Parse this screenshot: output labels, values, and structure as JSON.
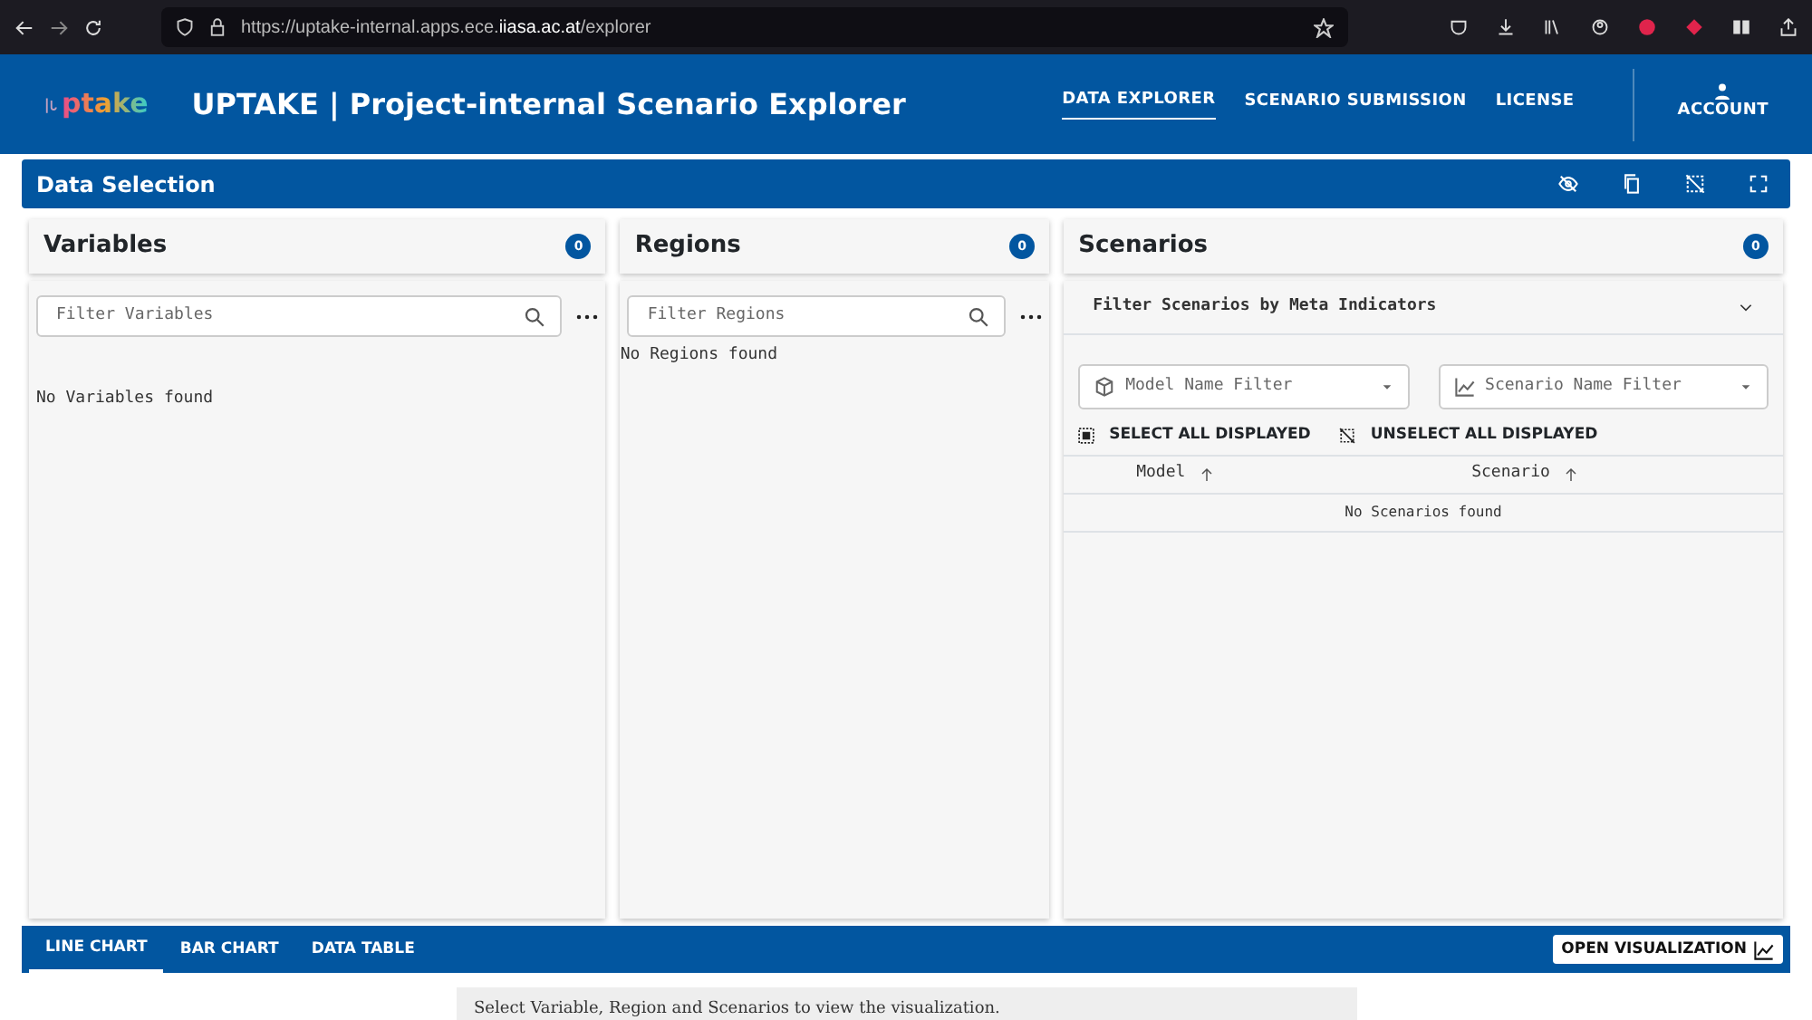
{
  "browser": {
    "url_prefix": "https://uptake-internal.apps.ece.",
    "url_host": "iiasa.ac.at",
    "url_path": "/explorer"
  },
  "header": {
    "logo": "ptake",
    "title": "UPTAKE | Project-internal Scenario Explorer",
    "nav": [
      {
        "label": "DATA EXPLORER",
        "selected": true
      },
      {
        "label": "SCENARIO SUBMISSION",
        "selected": false
      },
      {
        "label": "LICENSE",
        "selected": false
      }
    ],
    "account": "ACCOUNT"
  },
  "data_selection": {
    "title": "Data Selection"
  },
  "panels": [
    {
      "kind": "list",
      "title": "Variables",
      "count": "0",
      "placeholder": "Filter Variables",
      "empty": "No Variables found"
    },
    {
      "kind": "list",
      "title": "Regions",
      "count": "0",
      "placeholder": "Filter Regions",
      "empty": "No Regions found"
    },
    {
      "kind": "scenarios",
      "title": "Scenarios",
      "count": "0",
      "meta_filter": "Filter Scenarios by Meta Indicators",
      "expanded": false,
      "model_filter": {
        "placeholder": "Model Name Filter"
      },
      "scenario_filter": {
        "placeholder": "Scenario Name Filter"
      },
      "select_all": "SELECT ALL DISPLAYED",
      "unselect_all": "UNSELECT ALL DISPLAYED",
      "columns": [
        "Model",
        "Scenario"
      ],
      "empty": "No Scenarios found"
    }
  ],
  "viz_tabs": [
    {
      "label": "LINE CHART",
      "selected": true
    },
    {
      "label": "BAR CHART",
      "selected": false
    },
    {
      "label": "DATA TABLE",
      "selected": false
    }
  ],
  "open_visualization": "OPEN VISUALIZATION",
  "message": "Select Variable, Region and Scenarios to view the visualization."
}
